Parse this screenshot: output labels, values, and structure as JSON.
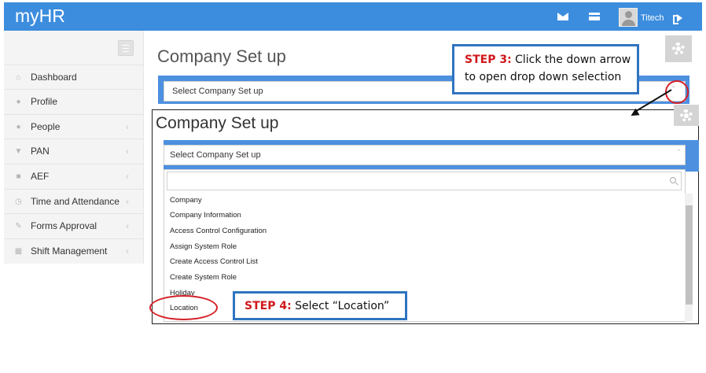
{
  "app": {
    "title": "myHR"
  },
  "header": {
    "username": "Titech",
    "icons": [
      "envelope-icon",
      "card-icon",
      "user-avatar",
      "logout-icon"
    ]
  },
  "sidebar": {
    "items": [
      {
        "label": "Dashboard",
        "icon": "home-icon",
        "has_chevron": false
      },
      {
        "label": "Profile",
        "icon": "user-icon",
        "has_chevron": false
      },
      {
        "label": "People",
        "icon": "people-icon",
        "has_chevron": true
      },
      {
        "label": "PAN",
        "icon": "trophy-icon",
        "has_chevron": true
      },
      {
        "label": "AEF",
        "icon": "folder-icon",
        "has_chevron": true
      },
      {
        "label": "Time and Attendance",
        "icon": "clock-icon",
        "has_chevron": true
      },
      {
        "label": "Forms Approval",
        "icon": "pencil-icon",
        "has_chevron": true
      },
      {
        "label": "Shift Management",
        "icon": "calendar-icon",
        "has_chevron": true
      }
    ],
    "chevron": "‹"
  },
  "main": {
    "page_title": "Company Set up",
    "select_placeholder": "Select Company Set up"
  },
  "zoom": {
    "page_title": "Company Set up",
    "select_placeholder": "Select Company Set up",
    "options": [
      "Company",
      "Company Information",
      "Access Control Configuration",
      "Assign System Role",
      "Create Access Control List",
      "Create System Role",
      "Holiday",
      "Location"
    ]
  },
  "callouts": {
    "step3": {
      "step": "STEP 3:",
      "text1": "Click the down arrow",
      "text2": "to open drop down selection"
    },
    "step4": {
      "step": "STEP 4:",
      "text": "Select “Location”"
    }
  },
  "colors": {
    "topbar": "#3c8dde",
    "band": "#4d90e0",
    "callout_border": "#2f74c0",
    "step_red": "#d0171b",
    "ring_red": "#d42127"
  }
}
